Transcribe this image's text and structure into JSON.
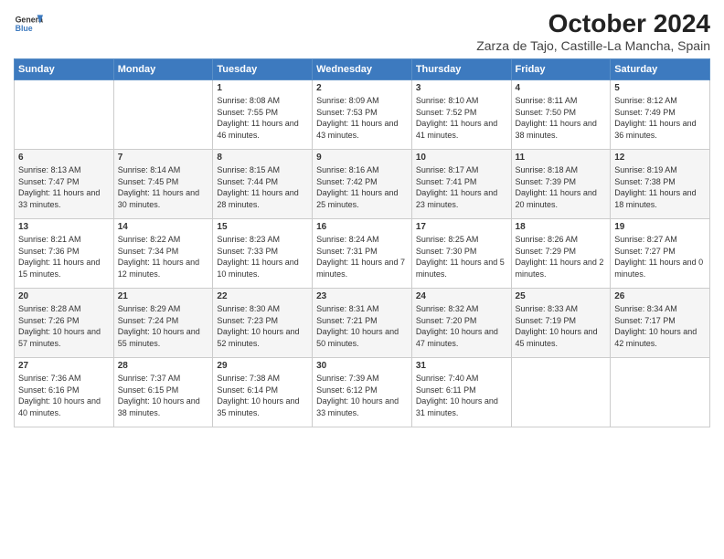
{
  "header": {
    "logo_line1": "General",
    "logo_line2": "Blue",
    "month_title": "October 2024",
    "location": "Zarza de Tajo, Castille-La Mancha, Spain"
  },
  "weekdays": [
    "Sunday",
    "Monday",
    "Tuesday",
    "Wednesday",
    "Thursday",
    "Friday",
    "Saturday"
  ],
  "weeks": [
    [
      {
        "day": "",
        "info": ""
      },
      {
        "day": "",
        "info": ""
      },
      {
        "day": "1",
        "info": "Sunrise: 8:08 AM\nSunset: 7:55 PM\nDaylight: 11 hours and 46 minutes."
      },
      {
        "day": "2",
        "info": "Sunrise: 8:09 AM\nSunset: 7:53 PM\nDaylight: 11 hours and 43 minutes."
      },
      {
        "day": "3",
        "info": "Sunrise: 8:10 AM\nSunset: 7:52 PM\nDaylight: 11 hours and 41 minutes."
      },
      {
        "day": "4",
        "info": "Sunrise: 8:11 AM\nSunset: 7:50 PM\nDaylight: 11 hours and 38 minutes."
      },
      {
        "day": "5",
        "info": "Sunrise: 8:12 AM\nSunset: 7:49 PM\nDaylight: 11 hours and 36 minutes."
      }
    ],
    [
      {
        "day": "6",
        "info": "Sunrise: 8:13 AM\nSunset: 7:47 PM\nDaylight: 11 hours and 33 minutes."
      },
      {
        "day": "7",
        "info": "Sunrise: 8:14 AM\nSunset: 7:45 PM\nDaylight: 11 hours and 30 minutes."
      },
      {
        "day": "8",
        "info": "Sunrise: 8:15 AM\nSunset: 7:44 PM\nDaylight: 11 hours and 28 minutes."
      },
      {
        "day": "9",
        "info": "Sunrise: 8:16 AM\nSunset: 7:42 PM\nDaylight: 11 hours and 25 minutes."
      },
      {
        "day": "10",
        "info": "Sunrise: 8:17 AM\nSunset: 7:41 PM\nDaylight: 11 hours and 23 minutes."
      },
      {
        "day": "11",
        "info": "Sunrise: 8:18 AM\nSunset: 7:39 PM\nDaylight: 11 hours and 20 minutes."
      },
      {
        "day": "12",
        "info": "Sunrise: 8:19 AM\nSunset: 7:38 PM\nDaylight: 11 hours and 18 minutes."
      }
    ],
    [
      {
        "day": "13",
        "info": "Sunrise: 8:21 AM\nSunset: 7:36 PM\nDaylight: 11 hours and 15 minutes."
      },
      {
        "day": "14",
        "info": "Sunrise: 8:22 AM\nSunset: 7:34 PM\nDaylight: 11 hours and 12 minutes."
      },
      {
        "day": "15",
        "info": "Sunrise: 8:23 AM\nSunset: 7:33 PM\nDaylight: 11 hours and 10 minutes."
      },
      {
        "day": "16",
        "info": "Sunrise: 8:24 AM\nSunset: 7:31 PM\nDaylight: 11 hours and 7 minutes."
      },
      {
        "day": "17",
        "info": "Sunrise: 8:25 AM\nSunset: 7:30 PM\nDaylight: 11 hours and 5 minutes."
      },
      {
        "day": "18",
        "info": "Sunrise: 8:26 AM\nSunset: 7:29 PM\nDaylight: 11 hours and 2 minutes."
      },
      {
        "day": "19",
        "info": "Sunrise: 8:27 AM\nSunset: 7:27 PM\nDaylight: 11 hours and 0 minutes."
      }
    ],
    [
      {
        "day": "20",
        "info": "Sunrise: 8:28 AM\nSunset: 7:26 PM\nDaylight: 10 hours and 57 minutes."
      },
      {
        "day": "21",
        "info": "Sunrise: 8:29 AM\nSunset: 7:24 PM\nDaylight: 10 hours and 55 minutes."
      },
      {
        "day": "22",
        "info": "Sunrise: 8:30 AM\nSunset: 7:23 PM\nDaylight: 10 hours and 52 minutes."
      },
      {
        "day": "23",
        "info": "Sunrise: 8:31 AM\nSunset: 7:21 PM\nDaylight: 10 hours and 50 minutes."
      },
      {
        "day": "24",
        "info": "Sunrise: 8:32 AM\nSunset: 7:20 PM\nDaylight: 10 hours and 47 minutes."
      },
      {
        "day": "25",
        "info": "Sunrise: 8:33 AM\nSunset: 7:19 PM\nDaylight: 10 hours and 45 minutes."
      },
      {
        "day": "26",
        "info": "Sunrise: 8:34 AM\nSunset: 7:17 PM\nDaylight: 10 hours and 42 minutes."
      }
    ],
    [
      {
        "day": "27",
        "info": "Sunrise: 7:36 AM\nSunset: 6:16 PM\nDaylight: 10 hours and 40 minutes."
      },
      {
        "day": "28",
        "info": "Sunrise: 7:37 AM\nSunset: 6:15 PM\nDaylight: 10 hours and 38 minutes."
      },
      {
        "day": "29",
        "info": "Sunrise: 7:38 AM\nSunset: 6:14 PM\nDaylight: 10 hours and 35 minutes."
      },
      {
        "day": "30",
        "info": "Sunrise: 7:39 AM\nSunset: 6:12 PM\nDaylight: 10 hours and 33 minutes."
      },
      {
        "day": "31",
        "info": "Sunrise: 7:40 AM\nSunset: 6:11 PM\nDaylight: 10 hours and 31 minutes."
      },
      {
        "day": "",
        "info": ""
      },
      {
        "day": "",
        "info": ""
      }
    ]
  ]
}
